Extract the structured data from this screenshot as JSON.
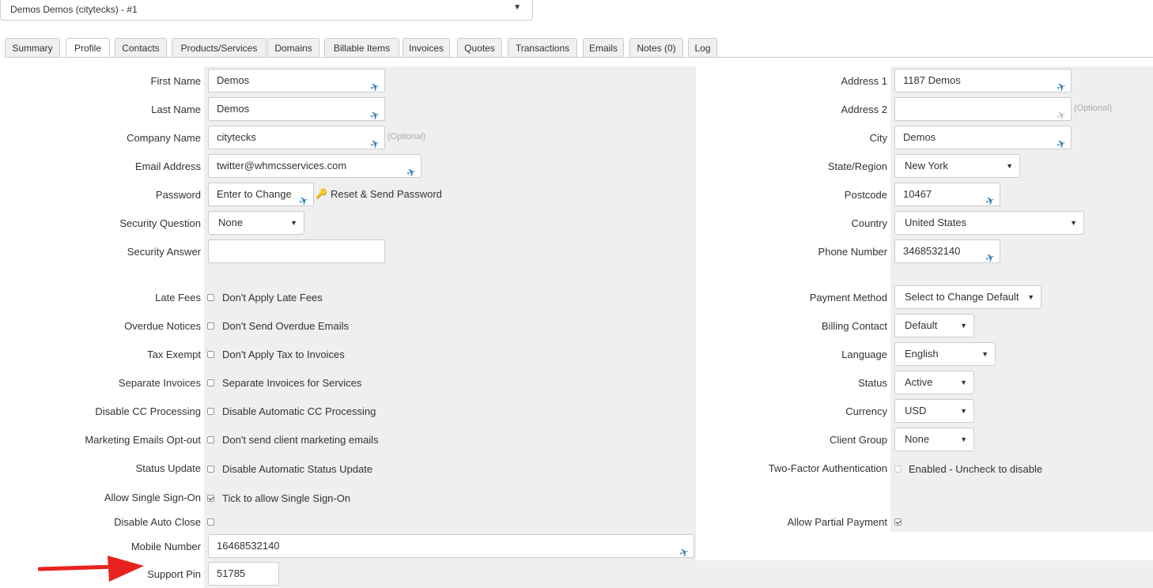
{
  "client_select": {
    "value": "Demos Demos (citytecks) - #1"
  },
  "tabs": [
    "Summary",
    "Profile",
    "Contacts",
    "Products/Services",
    "Domains",
    "Billable Items",
    "Invoices",
    "Quotes",
    "Transactions",
    "Emails",
    "Notes (0)",
    "Log"
  ],
  "active_tab": "Profile",
  "left": {
    "first_name": {
      "label": "First Name",
      "value": "Demos"
    },
    "last_name": {
      "label": "Last Name",
      "value": "Demos"
    },
    "company_name": {
      "label": "Company Name",
      "value": "citytecks",
      "optional": "(Optional)"
    },
    "email": {
      "label": "Email Address",
      "value": "twitter@whmcsservices.com"
    },
    "password": {
      "label": "Password",
      "value": "Enter to Change",
      "reset_link": "Reset & Send Password"
    },
    "security_question": {
      "label": "Security Question",
      "value": "None"
    },
    "security_answer": {
      "label": "Security Answer",
      "value": ""
    },
    "late_fees": {
      "label": "Late Fees",
      "text": "Don't Apply Late Fees",
      "checked": false
    },
    "overdue_notices": {
      "label": "Overdue Notices",
      "text": "Don't Send Overdue Emails",
      "checked": false
    },
    "tax_exempt": {
      "label": "Tax Exempt",
      "text": "Don't Apply Tax to Invoices",
      "checked": false
    },
    "separate_invoices": {
      "label": "Separate Invoices",
      "text": "Separate Invoices for Services",
      "checked": false
    },
    "disable_cc": {
      "label": "Disable CC Processing",
      "text": "Disable Automatic CC Processing",
      "checked": false
    },
    "marketing_optout": {
      "label": "Marketing Emails Opt-out",
      "text": "Don't send client marketing emails",
      "checked": false
    },
    "status_update": {
      "label": "Status Update",
      "text": "Disable Automatic Status Update",
      "checked": false
    },
    "sso": {
      "label": "Allow Single Sign-On",
      "text": "Tick to allow Single Sign-On",
      "checked": true
    },
    "auto_close": {
      "label": "Disable Auto Close",
      "checked": false
    },
    "mobile": {
      "label": "Mobile Number",
      "value": "16468532140"
    },
    "support_pin": {
      "label": "Support Pin",
      "value": "51785"
    }
  },
  "right": {
    "address1": {
      "label": "Address 1",
      "value": "1187 Demos"
    },
    "address2": {
      "label": "Address 2",
      "value": "",
      "optional": "(Optional)"
    },
    "city": {
      "label": "City",
      "value": "Demos"
    },
    "state": {
      "label": "State/Region",
      "value": "New York"
    },
    "postcode": {
      "label": "Postcode",
      "value": "10467"
    },
    "country": {
      "label": "Country",
      "value": "United States"
    },
    "phone": {
      "label": "Phone Number",
      "value": "3468532140"
    },
    "payment_method": {
      "label": "Payment Method",
      "value": "Select to Change Default"
    },
    "billing_contact": {
      "label": "Billing Contact",
      "value": "Default"
    },
    "language": {
      "label": "Language",
      "value": "English"
    },
    "status": {
      "label": "Status",
      "value": "Active"
    },
    "currency": {
      "label": "Currency",
      "value": "USD"
    },
    "client_group": {
      "label": "Client Group",
      "value": "None"
    },
    "two_factor": {
      "label": "Two-Factor Authentication",
      "text": "Enabled - Uncheck to disable",
      "checked": false
    },
    "partial_payment": {
      "label": "Allow Partial Payment",
      "checked": true
    }
  },
  "colors": {
    "accent_arrow": "#e8231f",
    "pin_icon": "#2f7fb3",
    "row_bg": "#efefef"
  }
}
